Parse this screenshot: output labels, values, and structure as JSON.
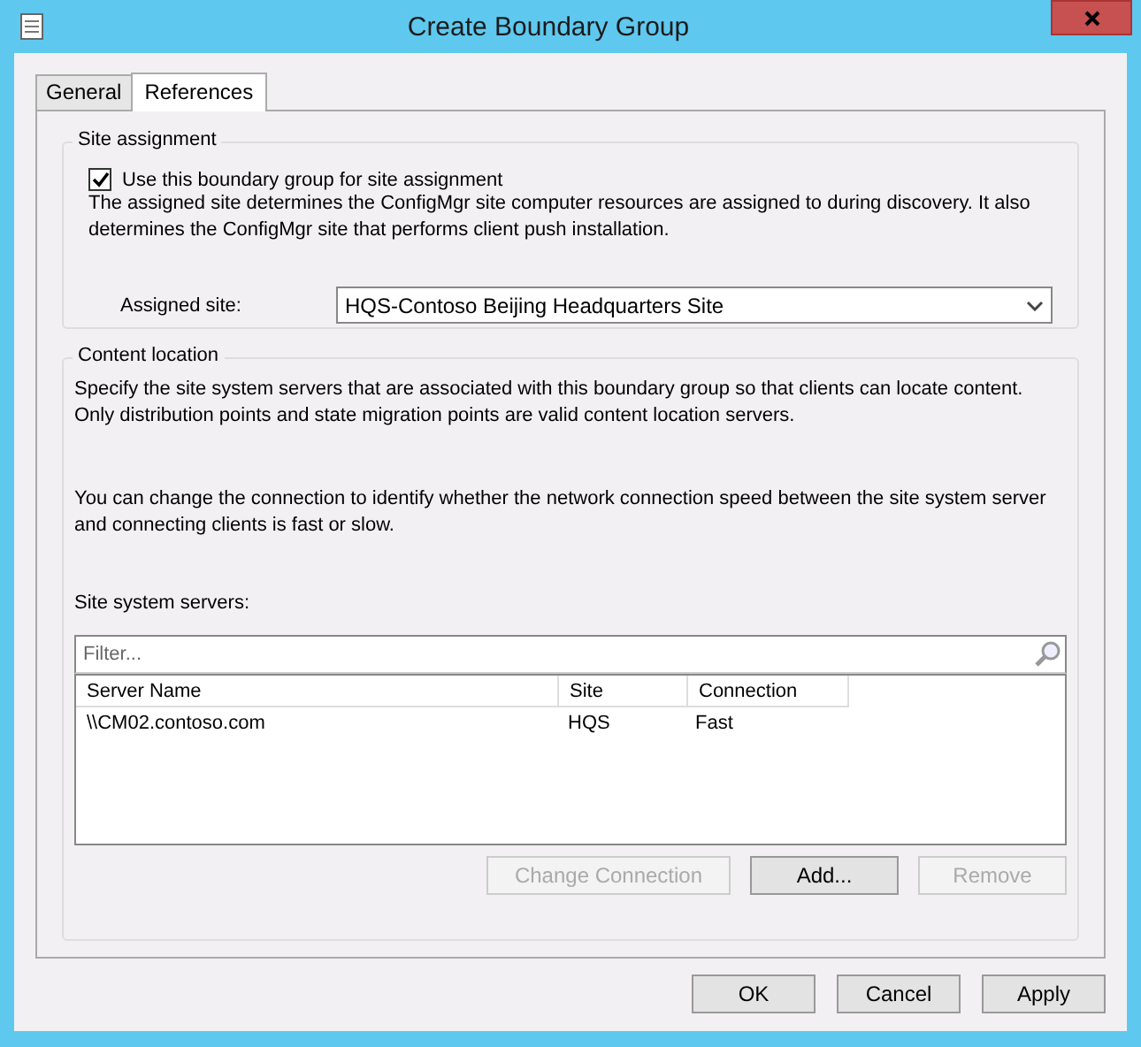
{
  "window": {
    "title": "Create Boundary Group"
  },
  "tabs": [
    {
      "label": "General",
      "selected": false
    },
    {
      "label": "References",
      "selected": true
    }
  ],
  "site_assignment": {
    "legend": "Site assignment",
    "checkbox": {
      "label": "Use this boundary group for site assignment",
      "checked": true
    },
    "description": "The assigned site determines the ConfigMgr site computer resources are assigned to during discovery. It also determines the ConfigMgr site that performs client push installation.",
    "assigned_site": {
      "label": "Assigned site:",
      "value": "HQS-Contoso Beijing Headquarters Site"
    }
  },
  "content_location": {
    "legend": "Content location",
    "description": "Specify the site system servers that are associated with this boundary group so that clients can locate content. Only distribution points and state migration points are valid content location servers.",
    "note": "You can change the connection to identify whether the network connection speed between the site system server and connecting clients is fast or slow.",
    "list_label": "Site system servers:",
    "filter": {
      "placeholder": "Filter..."
    },
    "table": {
      "columns": [
        "Server Name",
        "Site",
        "Connection"
      ],
      "rows": [
        [
          "\\\\CM02.contoso.com",
          "HQS",
          "Fast"
        ]
      ]
    },
    "buttons": [
      {
        "label": "Change Connection",
        "disabled": true
      },
      {
        "label": "Add...",
        "disabled": false
      },
      {
        "label": "Remove",
        "disabled": true
      }
    ]
  },
  "buttons": [
    {
      "label": "OK",
      "disabled": false
    },
    {
      "label": "Cancel",
      "disabled": false
    },
    {
      "label": "Apply",
      "disabled": false
    }
  ]
}
